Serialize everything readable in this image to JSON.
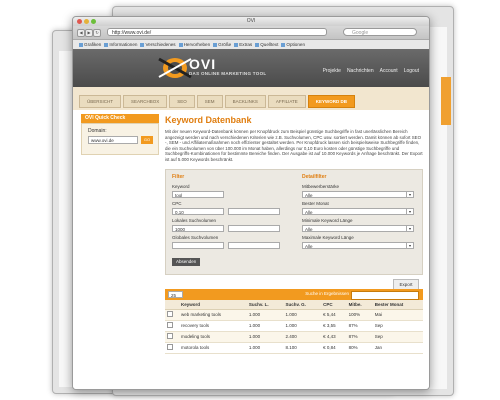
{
  "browser": {
    "title": "OVI",
    "url": "http://www.ovi.de/",
    "search_placeholder": "Google",
    "bookmarks": [
      "Grafiken",
      "Informationen",
      "Verschiedenes",
      "Hervorheben",
      "Größe",
      "Extras",
      "Quelltext",
      "Optionen"
    ]
  },
  "site": {
    "logo_text": "OVI",
    "logo_sub": "DAS ONLINE MARKETING TOOL",
    "top_links": [
      "Projekte",
      "Nachrichten",
      "Account",
      "Logout"
    ],
    "tabs": [
      "ÜBERSICHT",
      "SEARCHBOX",
      "SEO",
      "SEM",
      "BACKLINKS",
      "AFFILIATE",
      "KEYWORD DB"
    ],
    "active_tab": "KEYWORD DB"
  },
  "sidebar": {
    "title": "OVI Quick Check",
    "domain_label": "Domain:",
    "domain_value": "www.ovi.de",
    "go_label": "GO"
  },
  "main": {
    "title": "Keyword Datenbank",
    "intro": "Mit der neuen Keyword-Datenbank können per Knopfdruck zum Beispiel günstige Suchbegriffe in fast unerlässlichen Bereich angezeigt werden und nach verschiedenen Kriterien wie z.B. Suchvolumen, CPC usw. sortiert werden. Damit können ab sofort SEO -, SEM - und Affiliatemaßnahmen noch effizienter gestaltet werden. Per Knopfdruck lassen sich beispielsweise Suchbegriffe finden, die ein Suchvolumen von über 100.000 im Monat haben, allerdings nur 0,10 Euro kosten oder günstige Suchbegriffe und Suchbegriffs-Kombinationen für bestimmte Bereiche finden. Der Ausgabe ist auf 10.000 Keywords je Anfrage beschränkt. Der Export ist auf 5.000 Keywords beschränkt.",
    "filter": {
      "title": "Filter",
      "keyword_label": "Keyword",
      "keyword_value": "tool",
      "cpc_label": "CPC",
      "cpc_value": "0,10",
      "lokales_label": "Lokales Suchvolumen",
      "lokales_value": "1000",
      "globales_label": "Globales Suchvolumen",
      "button": "Absenden"
    },
    "details": {
      "title": "Detailfilter",
      "wettbewerb_label": "Mitbewerberstärke",
      "wettbewerb_value": "Alle",
      "monat_label": "Bester Monat",
      "monat_value": "Alle",
      "minlen_label": "Minimale Keyword Länge",
      "minlen_value": "Alle",
      "maxlen_label": "Maximale Keyword Länge",
      "maxlen_value": "Alle"
    },
    "export_label": "Export",
    "per_page": "25",
    "search_results_label": "Suche in Ergebnissen",
    "table": {
      "headers": [
        "",
        "Keyword",
        "Suchv. L.",
        "Suchv. G.",
        "CPC",
        "Mitbe.",
        "Bester Monat"
      ],
      "rows": [
        [
          "",
          "web marketing tools",
          "1.000",
          "1.000",
          "€ 5,44",
          "100%",
          "Mai"
        ],
        [
          "",
          "recovery tools",
          "1.000",
          "1.000",
          "€ 3,55",
          "87%",
          "Sep"
        ],
        [
          "",
          "modeling tools",
          "1.000",
          "2.400",
          "€ 4,43",
          "87%",
          "Sep"
        ],
        [
          "",
          "motorola tools",
          "1.000",
          "8.100",
          "€ 0,84",
          "80%",
          "Jan"
        ]
      ]
    }
  }
}
